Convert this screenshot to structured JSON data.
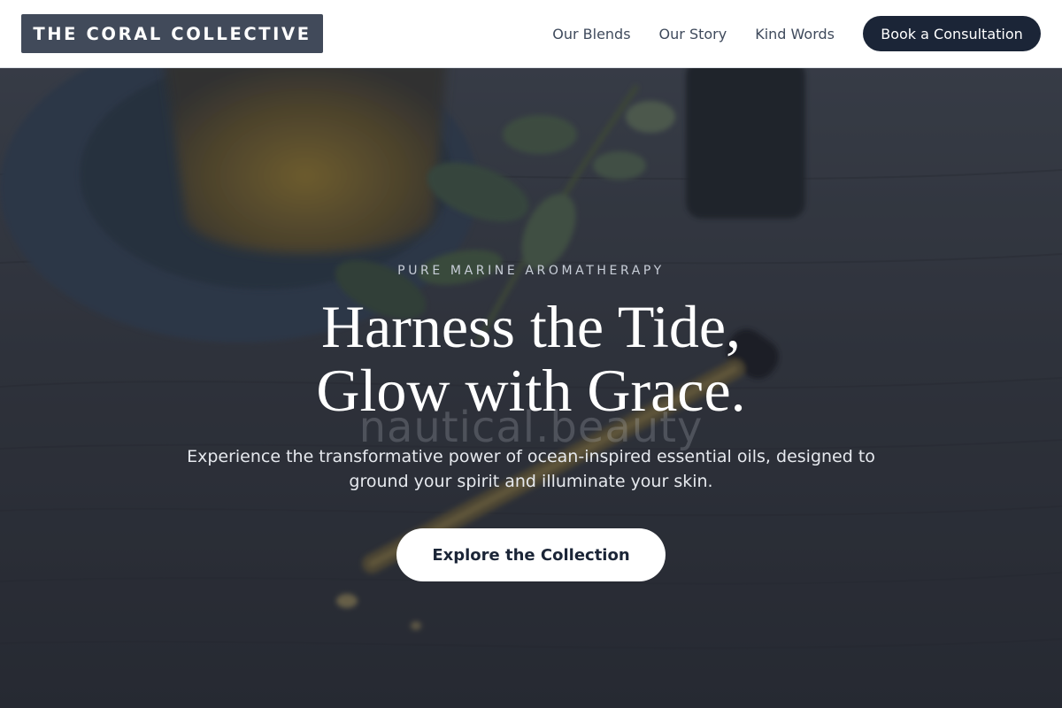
{
  "brand": {
    "name": "THE CORAL COLLECTIVE"
  },
  "nav": {
    "links": [
      {
        "label": "Our Blends"
      },
      {
        "label": "Our Story"
      },
      {
        "label": "Kind Words"
      }
    ],
    "cta_label": "Book a Consultation"
  },
  "hero": {
    "eyebrow": "PURE MARINE AROMATHERAPY",
    "headline_line1": "Harness the Tide,",
    "headline_line2": "Glow with Grace.",
    "watermark": "nautical.beauty",
    "subtext": "Experience the transformative power of ocean-inspired essential oils, designed to ground your spirit and illuminate your skin.",
    "cta_label": "Explore the Collection"
  },
  "colors": {
    "header_bg": "#ffffff",
    "logo_bg": "#414a5a",
    "nav_text": "#3f4a5c",
    "primary_button": "#1b2537",
    "hero_overlay": "#1c222e"
  }
}
